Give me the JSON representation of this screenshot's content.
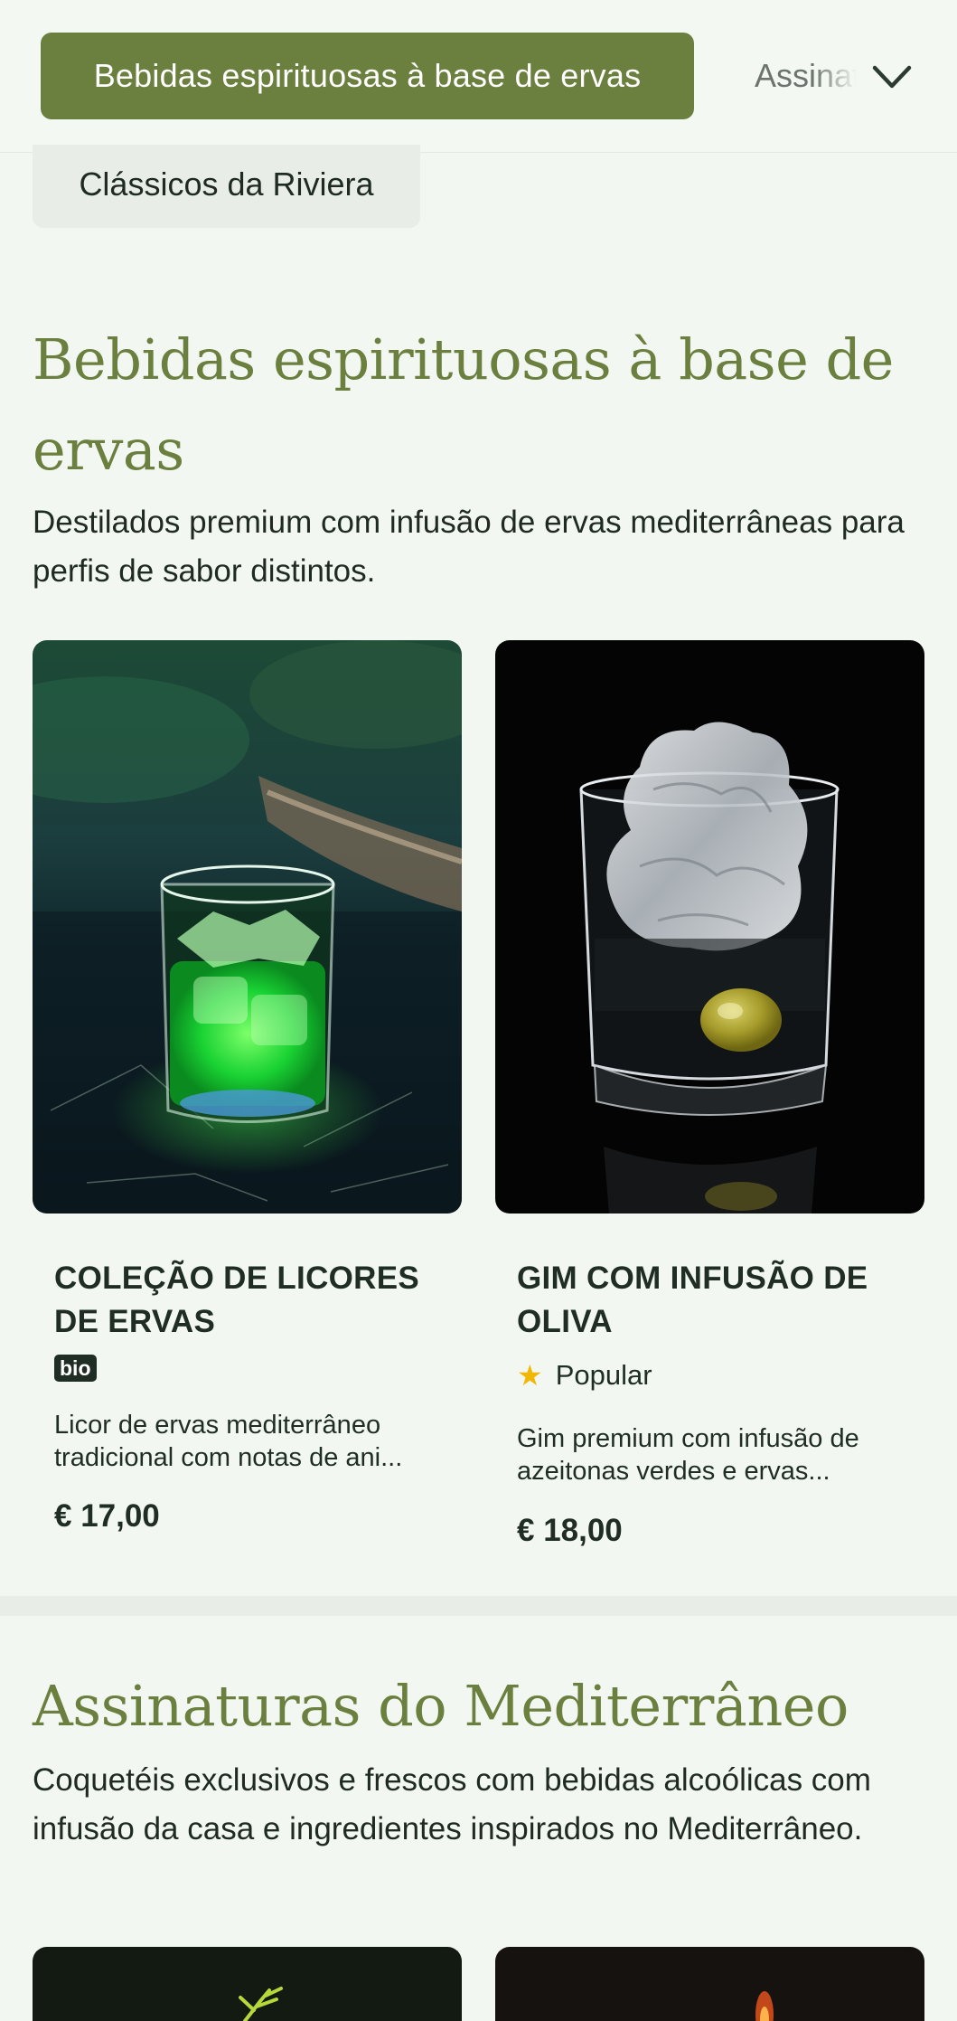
{
  "category_nav": {
    "active_label": "Bebidas espirituosas à base de ervas",
    "next_label": "Assinaturas do Mediterrâneo",
    "second_row_label": "Clássicos da Riviera"
  },
  "sections": [
    {
      "title": "Bebidas espirituosas à base de ervas",
      "description": "Destilados premium com infusão de ervas mediterrâneas para perfis de sabor distintos.",
      "products": [
        {
          "name": "COLEÇÃO DE LICORES DE ERVAS",
          "badge": "bio",
          "description": "Licor de ervas mediterrâneo tradicional com notas de ani...",
          "price": "€ 17,00",
          "image_icon": "green-liqueur-glass-image"
        },
        {
          "name": "GIM COM INFUSÃO DE OLIVA",
          "badge": "Popular",
          "badge_icon": "star-icon",
          "description": "Gim premium com infusão de azeitonas verdes e ervas...",
          "price": "€ 18,00",
          "image_icon": "gin-olive-glass-image"
        }
      ]
    },
    {
      "title": "Assinaturas do Mediterrâneo",
      "description": "Coquetéis exclusivos e frescos com bebidas alcoólicas com infusão da casa e ingredientes inspirados no Mediterrâneo."
    }
  ],
  "colors": {
    "accent": "#6b7f3e",
    "background": "#f3f7f2",
    "text": "#1f2a22",
    "star": "#f2b705"
  }
}
